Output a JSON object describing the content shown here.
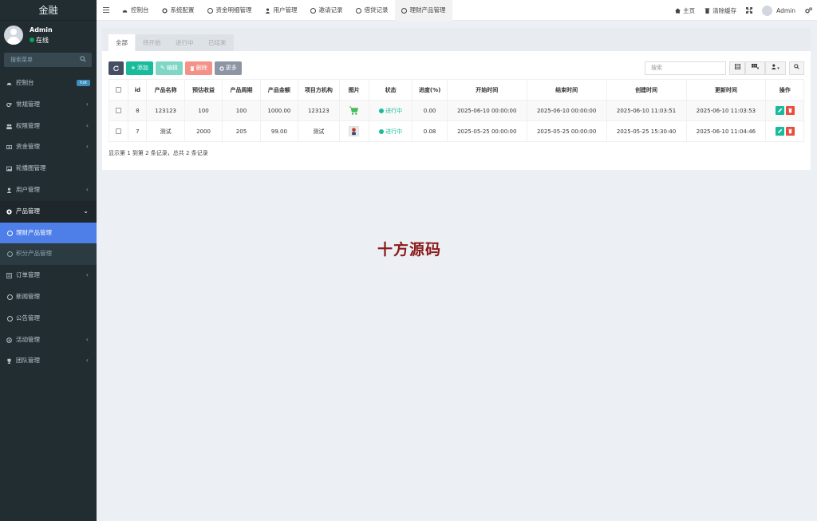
{
  "sidebar": {
    "brand": "金融",
    "user": {
      "name": "Admin",
      "status": "在线"
    },
    "search_placeholder": "搜索菜单",
    "items": [
      {
        "label": "控制台",
        "icon": "dashboard-icon",
        "badge": "hot"
      },
      {
        "label": "常规管理",
        "icon": "cogs-icon",
        "chevron": "‹"
      },
      {
        "label": "权限管理",
        "icon": "group-icon",
        "chevron": "‹"
      },
      {
        "label": "资金管理",
        "icon": "money-icon",
        "chevron": "‹"
      },
      {
        "label": "轮播图管理",
        "icon": "image-icon"
      },
      {
        "label": "用户管理",
        "icon": "user-icon",
        "chevron": "‹"
      },
      {
        "label": "产品管理",
        "icon": "product-icon",
        "chevron": "⌄"
      },
      {
        "label": "理财产品管理",
        "icon": "circle-icon"
      },
      {
        "label": "积分产品管理",
        "icon": "circle-icon"
      },
      {
        "label": "订单管理",
        "icon": "list-icon",
        "chevron": "‹"
      },
      {
        "label": "新闻管理",
        "icon": "circle-icon"
      },
      {
        "label": "公告管理",
        "icon": "circle-icon"
      },
      {
        "label": "活动管理",
        "icon": "gear-icon",
        "chevron": "‹"
      },
      {
        "label": "团队管理",
        "icon": "trophy-icon",
        "chevron": "‹"
      }
    ]
  },
  "topnav": {
    "tabs": [
      {
        "label": "控制台"
      },
      {
        "label": "系统配置"
      },
      {
        "label": "资金明细管理"
      },
      {
        "label": "用户管理"
      },
      {
        "label": "邀请记录"
      },
      {
        "label": "借贷记录"
      },
      {
        "label": "理财产品管理"
      }
    ],
    "home": "主页",
    "clear_cache": "清除缓存",
    "user": "Admin"
  },
  "filter_tabs": [
    "全部",
    "待开始",
    "进行中",
    "已结束"
  ],
  "toolbar": {
    "add": "添加",
    "edit": "编辑",
    "delete": "删除",
    "more": "更多",
    "search_placeholder": "搜索"
  },
  "table": {
    "columns": [
      "id",
      "产品名称",
      "预估收益",
      "产品周期",
      "产品金额",
      "项目方机构",
      "图片",
      "状态",
      "进度(%)",
      "开始时间",
      "结束时间",
      "创建时间",
      "更新时间",
      "操作"
    ],
    "rows": [
      {
        "id": "8",
        "name": "123123",
        "income": "100",
        "cycle": "100",
        "amount": "1000.00",
        "org": "123123",
        "status": "进行中",
        "progress": "0.00",
        "start": "2025-06-10 00:00:00",
        "end": "2025-06-10 00:00:00",
        "created": "2025-06-10 11:03:51",
        "updated": "2025-06-10 11:03:53"
      },
      {
        "id": "7",
        "name": "测试",
        "income": "2000",
        "cycle": "205",
        "amount": "99.00",
        "org": "测试",
        "status": "进行中",
        "progress": "0.08",
        "start": "2025-05-25 00:00:00",
        "end": "2025-05-25 00:00:00",
        "created": "2025-05-25 15:30:40",
        "updated": "2025-06-10 11:04:46"
      }
    ]
  },
  "pager_text": "显示第 1 到第 2 条记录，总共 2 条记录",
  "watermark": "十方源码"
}
